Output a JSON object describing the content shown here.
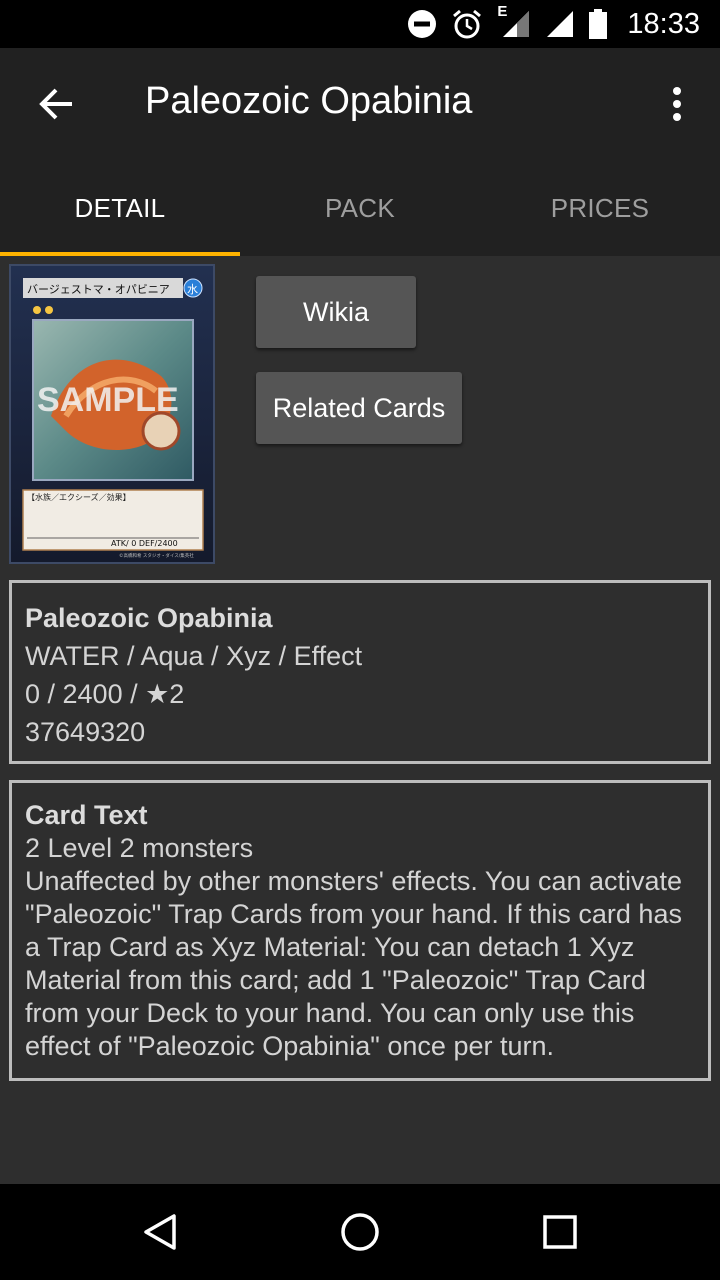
{
  "status_bar": {
    "time": "18:33",
    "network_label": "E",
    "icons": [
      "do-not-disturb-icon",
      "alarm-icon",
      "signal-e-icon",
      "signal-icon",
      "battery-icon"
    ]
  },
  "toolbar": {
    "title": "Paleozoic Opabinia",
    "back_icon": "arrow-back-icon",
    "menu_icon": "more-vert-icon"
  },
  "tabs": [
    {
      "label": "DETAIL",
      "active": true
    },
    {
      "label": "PACK",
      "active": false
    },
    {
      "label": "PRICES",
      "active": false
    }
  ],
  "card_image": {
    "jp_name": "バージェストマ・オパビニア",
    "attribute": "水",
    "watermark": "SAMPLE",
    "type_line": "【水族／エクシーズ／効果】",
    "stats": "ATK/ 0 DEF/2400",
    "copyright": "©高橋和希 スタジオ・ダイス/集英社"
  },
  "buttons": {
    "wikia": "Wikia",
    "related": "Related Cards"
  },
  "info": {
    "name": "Paleozoic Opabinia",
    "type": "WATER / Aqua / Xyz / Effect",
    "stats": "0 / 2400 / ★2",
    "id": "37649320"
  },
  "card_text": {
    "heading": "Card Text",
    "materials": "2 Level 2 monsters",
    "effect": "Unaffected by other monsters' effects. You can activate \"Paleozoic\" Trap Cards from your hand. If this card has a Trap Card as Xyz Material: You can detach 1 Xyz Material from this card; add 1 \"Paleozoic\" Trap Card from your Deck to your hand. You can only use this effect of \"Paleozoic Opabinia\" once per turn."
  },
  "nav": [
    "back-triangle-icon",
    "home-circle-icon",
    "recents-square-icon"
  ],
  "colors": {
    "accent": "#ffb300",
    "toolbar": "#212121",
    "background": "#2e2e2e",
    "button": "#555555"
  }
}
